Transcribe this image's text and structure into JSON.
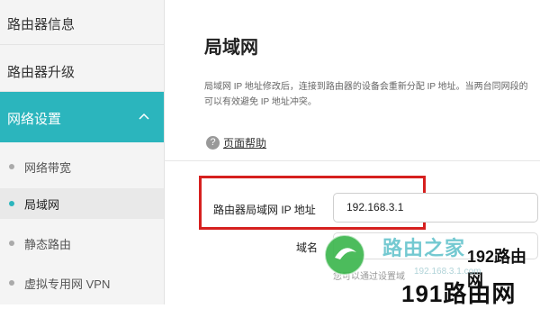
{
  "sidebar": {
    "items": [
      {
        "label": "路由器信息"
      },
      {
        "label": "路由器升级"
      }
    ],
    "active_group": {
      "label": "网络设置"
    },
    "sub_items": [
      {
        "label": "网络带宽"
      },
      {
        "label": "局域网"
      },
      {
        "label": "静态路由"
      },
      {
        "label": "虚拟专用网 VPN"
      }
    ],
    "accent_color": "#2bb5bd"
  },
  "main": {
    "title": "局域网",
    "description_line1": "局域网 IP 地址修改后，连接到路由器的设备会重新分配 IP 地址。当两台同网段的",
    "description_line2": "可以有效避免 IP 地址冲突。",
    "help_icon": "question-circle-icon",
    "help_link": "页面帮助",
    "lan_ip_label": "路由器局域网 IP 地址",
    "lan_ip_value": "192.168.3.1",
    "domain_label": "域名",
    "domain_value": "",
    "hint": "您可以通过设置域",
    "highlight_color": "#d6201f"
  },
  "watermark": {
    "text1": "路由之家",
    "text2": "192路由网",
    "url": "192.168.3.1.com",
    "text3": "191路由网"
  }
}
